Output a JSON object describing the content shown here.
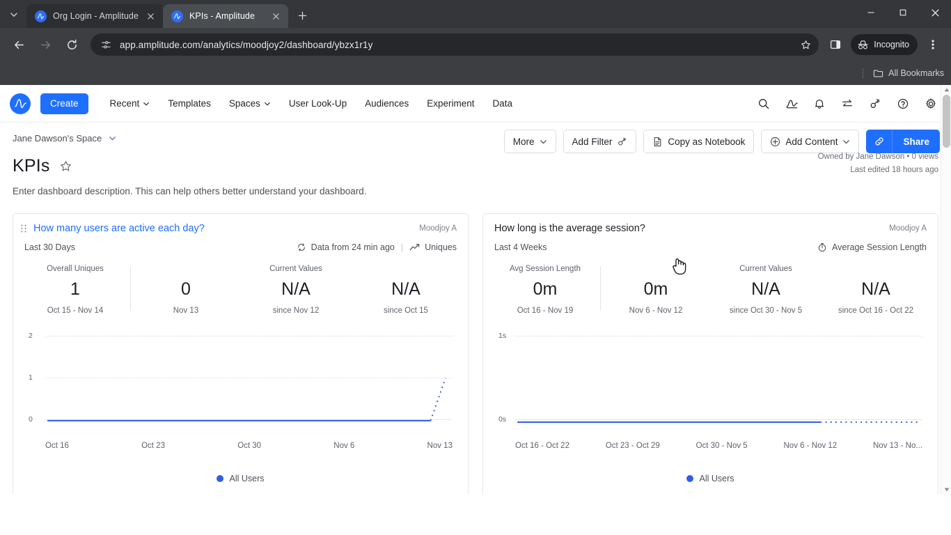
{
  "browser": {
    "tabs": [
      {
        "title": "Org Login - Amplitude",
        "active": false
      },
      {
        "title": "KPIs - Amplitude",
        "active": true
      }
    ],
    "url": "app.amplitude.com/analytics/moodjoy2/dashboard/ybzx1r1y",
    "incognito_label": "Incognito",
    "bookmarks_label": "All Bookmarks",
    "icons": {
      "tab_list": "chevron-down-icon",
      "new_tab": "plus-icon",
      "back": "back-arrow-icon",
      "forward": "forward-arrow-icon",
      "reload": "reload-icon",
      "site_info": "site-settings-icon",
      "bookmark": "star-icon",
      "side_panel": "side-panel-icon",
      "menu": "three-dot-menu-icon",
      "minimize": "minimize-icon",
      "maximize": "maximize-icon",
      "close": "close-icon",
      "folder": "folder-icon"
    }
  },
  "appnav": {
    "logo": "amplitude-logo",
    "create_label": "Create",
    "links": [
      {
        "label": "Recent",
        "caret": true
      },
      {
        "label": "Templates",
        "caret": false
      },
      {
        "label": "Spaces",
        "caret": true
      },
      {
        "label": "User Look-Up",
        "caret": false
      },
      {
        "label": "Audiences",
        "caret": false
      },
      {
        "label": "Experiment",
        "caret": false
      },
      {
        "label": "Data",
        "caret": false
      }
    ],
    "icons": [
      "search-icon",
      "analytics-icon",
      "bell-icon",
      "compare-icon",
      "ai-wand-icon",
      "help-icon",
      "gear-icon"
    ]
  },
  "header": {
    "breadcrumb": "Jane Dawson's Space",
    "title": "KPIs",
    "description": "Enter dashboard description. This can help others better understand your dashboard.",
    "owner_line": "Owned by Jane Dawson • 0 views",
    "edited_line": "Last edited 18 hours ago"
  },
  "toolbar": {
    "more_label": "More",
    "add_filter_label": "Add Filter",
    "copy_notebook_label": "Copy as Notebook",
    "add_content_label": "Add Content",
    "share_label": "Share",
    "link_icon": "link-icon"
  },
  "cards": [
    {
      "title": "How many users are active each day?",
      "owner": "Moodjoy A",
      "range": "Last 30 Days",
      "refresh_text": "Data from 24 min ago",
      "metric_label": "Uniques",
      "metric_icon": "line-chart-icon",
      "refresh_icon": "refresh-icon",
      "stats": {
        "overall": {
          "label": "Overall Uniques",
          "value": "1",
          "sub": "Oct 15 - Nov 14"
        },
        "current_values_label": "Current Values",
        "items": [
          {
            "value": "0",
            "sub": "Nov 13"
          },
          {
            "value": "N/A",
            "sub": "since Nov 12"
          },
          {
            "value": "N/A",
            "sub": "since Oct 15"
          }
        ]
      },
      "legend": "All Users"
    },
    {
      "title": "How long is the average session?",
      "owner": "Moodjoy A",
      "range": "Last 4 Weeks",
      "refresh_text": "",
      "metric_label": "Average Session Length",
      "metric_icon": "stopwatch-icon",
      "refresh_icon": "",
      "stats": {
        "overall": {
          "label": "Avg Session Length",
          "value": "0m",
          "sub": "Oct 16 - Nov 19"
        },
        "current_values_label": "Current Values",
        "items": [
          {
            "value": "0m",
            "sub": "Nov 6 - Nov 12"
          },
          {
            "value": "N/A",
            "sub": "since Oct 30 - Nov 5"
          },
          {
            "value": "N/A",
            "sub": "since Oct 16 - Oct 22"
          }
        ]
      },
      "legend": "All Users"
    }
  ],
  "chart_data": [
    {
      "type": "line",
      "title": "How many users are active each day?",
      "series": [
        {
          "name": "All Users",
          "x": [
            "Oct 16",
            "Oct 17",
            "Oct 18",
            "Oct 19",
            "Oct 20",
            "Oct 21",
            "Oct 22",
            "Oct 23",
            "Oct 24",
            "Oct 25",
            "Oct 26",
            "Oct 27",
            "Oct 28",
            "Oct 29",
            "Oct 30",
            "Oct 31",
            "Nov 1",
            "Nov 2",
            "Nov 3",
            "Nov 4",
            "Nov 5",
            "Nov 6",
            "Nov 7",
            "Nov 8",
            "Nov 9",
            "Nov 10",
            "Nov 11",
            "Nov 12",
            "Nov 13",
            "Nov 14"
          ],
          "values": [
            0,
            0,
            0,
            0,
            0,
            0,
            0,
            0,
            0,
            0,
            0,
            0,
            0,
            0,
            0,
            0,
            0,
            0,
            0,
            0,
            0,
            0,
            0,
            0,
            0,
            0,
            0,
            0,
            0,
            1
          ],
          "color": "#2f5ee8",
          "dashed_from_index": 28
        }
      ],
      "xlabel": "",
      "ylabel": "",
      "xticks": [
        "Oct 16",
        "Oct 23",
        "Oct 30",
        "Nov 6",
        "Nov 13"
      ],
      "yticks": [
        "0",
        "1",
        "2"
      ],
      "ylim": [
        0,
        2
      ],
      "grid": true,
      "legend_position": "bottom"
    },
    {
      "type": "line",
      "title": "How long is the average session?",
      "series": [
        {
          "name": "All Users",
          "x": [
            "Oct 16 - Oct 22",
            "Oct 23 - Oct 29",
            "Oct 30 - Nov 5",
            "Nov 6 - Nov 12",
            "Nov 13 - No..."
          ],
          "values": [
            0,
            0,
            0,
            0,
            0
          ],
          "color": "#2f5ee8",
          "dashed_from_index": 3
        }
      ],
      "xlabel": "",
      "ylabel": "",
      "xticks": [
        "Oct 16 - Oct 22",
        "Oct 23 - Oct 29",
        "Oct 30 - Nov 5",
        "Nov 6 - Nov 12",
        "Nov 13 - No..."
      ],
      "yticks": [
        "0s",
        "1s"
      ],
      "ylim": [
        0,
        1
      ],
      "grid": true,
      "legend_position": "bottom"
    }
  ]
}
